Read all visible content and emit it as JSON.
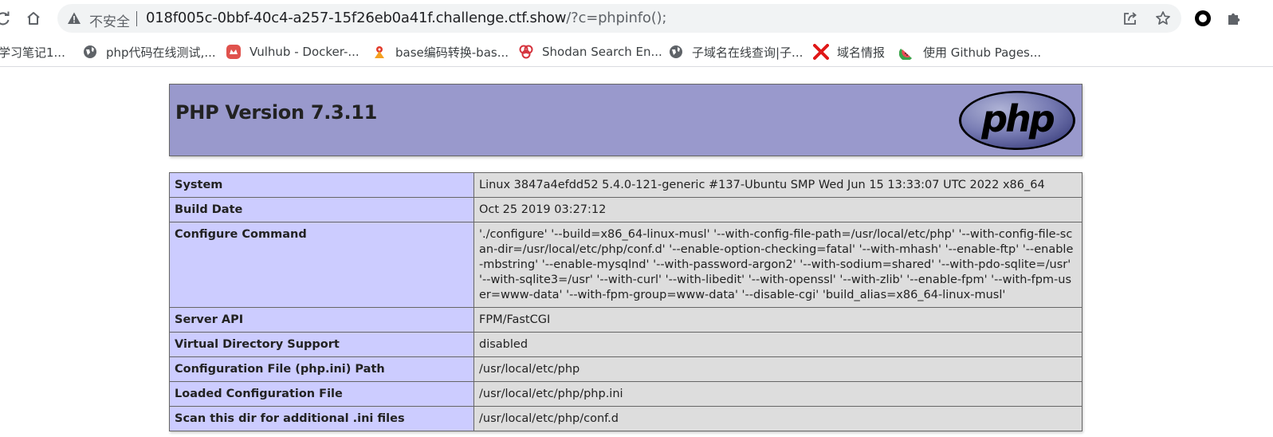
{
  "browser": {
    "security_label": "不安全",
    "url_host": "018f005c-0bbf-40c4-a257-15f26eb0a41f.challenge.ctf.show",
    "url_path": "/?c=phpinfo();"
  },
  "bookmarks": [
    {
      "label": "学习笔记1...",
      "icon": "notebook-icon"
    },
    {
      "label": "php代码在线测试,...",
      "icon": "globe-icon"
    },
    {
      "label": "Vulhub - Docker-...",
      "icon": "vulhub-icon"
    },
    {
      "label": "base编码转换-bas...",
      "icon": "base-icon"
    },
    {
      "label": "Shodan Search En...",
      "icon": "shodan-icon"
    },
    {
      "label": "子域名在线查询|子...",
      "icon": "globe-icon"
    },
    {
      "label": "域名情报",
      "icon": "x-icon"
    },
    {
      "label": "使用 Github Pages...",
      "icon": "watermelon-icon"
    }
  ],
  "php": {
    "title": "PHP Version 7.3.11",
    "rows": [
      {
        "key": "System",
        "value": "Linux 3847a4efdd52 5.4.0-121-generic #137-Ubuntu SMP Wed Jun 15 13:33:07 UTC 2022 x86_64"
      },
      {
        "key": "Build Date",
        "value": "Oct 25 2019 03:27:12"
      },
      {
        "key": "Configure Command",
        "value": "'./configure' '--build=x86_64-linux-musl' '--with-config-file-path=/usr/local/etc/php' '--with-config-file-scan-dir=/usr/local/etc/php/conf.d' '--enable-option-checking=fatal' '--with-mhash' '--enable-ftp' '--enable-mbstring' '--enable-mysqlnd' '--with-password-argon2' '--with-sodium=shared' '--with-pdo-sqlite=/usr' '--with-sqlite3=/usr' '--with-curl' '--with-libedit' '--with-openssl' '--with-zlib' '--enable-fpm' '--with-fpm-user=www-data' '--with-fpm-group=www-data' '--disable-cgi' 'build_alias=x86_64-linux-musl'"
      },
      {
        "key": "Server API",
        "value": "FPM/FastCGI"
      },
      {
        "key": "Virtual Directory Support",
        "value": "disabled"
      },
      {
        "key": "Configuration File (php.ini) Path",
        "value": "/usr/local/etc/php"
      },
      {
        "key": "Loaded Configuration File",
        "value": "/usr/local/etc/php/php.ini"
      },
      {
        "key": "Scan this dir for additional .ini files",
        "value": "/usr/local/etc/php/conf.d"
      }
    ]
  }
}
